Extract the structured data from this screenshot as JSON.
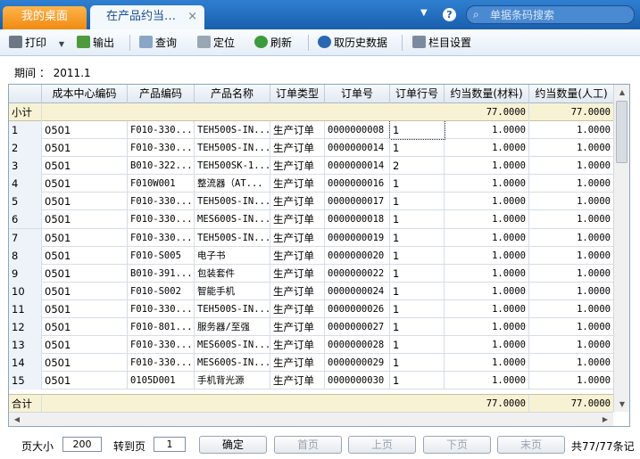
{
  "tabs": {
    "home": "我的桌面",
    "active": "在产品约当…",
    "close": "×"
  },
  "header": {
    "search_placeholder": "单据条码搜索",
    "help": "?",
    "caret": "▼",
    "search_glyph": "⌕"
  },
  "toolbar": {
    "print": "打印",
    "print_arrow": "▼",
    "export": "输出",
    "query": "查询",
    "locate": "定位",
    "refresh": "刷新",
    "history": "取历史数据",
    "columns": "栏目设置"
  },
  "period": {
    "label": "期间 ：",
    "value": "2011.1"
  },
  "table": {
    "headers": [
      "成本中心编码",
      "产品编码",
      "产品名称",
      "订单类型",
      "订单号",
      "订单行号",
      "约当数量(材料)",
      "约当数量(人工)"
    ],
    "subtotal": {
      "label": "小计",
      "material": "77.0000",
      "labor": "77.0000"
    },
    "total": {
      "label": "合计",
      "material": "77.0000",
      "labor": "77.0000"
    },
    "rows": [
      {
        "n": "1",
        "cc": "0501",
        "code": "F010-330...",
        "name": "TEH500S-IN...",
        "type": "生产订单",
        "order": "0000000008",
        "line": "1",
        "m": "1.0000",
        "l": "1.0000"
      },
      {
        "n": "2",
        "cc": "0501",
        "code": "F010-330...",
        "name": "TEH500S-IN...",
        "type": "生产订单",
        "order": "0000000014",
        "line": "1",
        "m": "1.0000",
        "l": "1.0000"
      },
      {
        "n": "3",
        "cc": "0501",
        "code": "B010-322...",
        "name": "TEH500SK-1...",
        "type": "生产订单",
        "order": "0000000014",
        "line": "2",
        "m": "1.0000",
        "l": "1.0000"
      },
      {
        "n": "4",
        "cc": "0501",
        "code": "F010W001",
        "name": "整流器（AT...",
        "type": "生产订单",
        "order": "0000000016",
        "line": "1",
        "m": "1.0000",
        "l": "1.0000"
      },
      {
        "n": "5",
        "cc": "0501",
        "code": "F010-330...",
        "name": "TEH500S-IN...",
        "type": "生产订单",
        "order": "0000000017",
        "line": "1",
        "m": "1.0000",
        "l": "1.0000"
      },
      {
        "n": "6",
        "cc": "0501",
        "code": "F010-330...",
        "name": "MES600S-IN...",
        "type": "生产订单",
        "order": "0000000018",
        "line": "1",
        "m": "1.0000",
        "l": "1.0000"
      },
      {
        "n": "7",
        "cc": "0501",
        "code": "F010-330...",
        "name": "TEH500S-IN...",
        "type": "生产订单",
        "order": "0000000019",
        "line": "1",
        "m": "1.0000",
        "l": "1.0000"
      },
      {
        "n": "8",
        "cc": "0501",
        "code": "F010-S005",
        "name": "电子书",
        "type": "生产订单",
        "order": "0000000020",
        "line": "1",
        "m": "1.0000",
        "l": "1.0000"
      },
      {
        "n": "9",
        "cc": "0501",
        "code": "B010-391...",
        "name": "包装套件",
        "type": "生产订单",
        "order": "0000000022",
        "line": "1",
        "m": "1.0000",
        "l": "1.0000"
      },
      {
        "n": "10",
        "cc": "0501",
        "code": "F010-S002",
        "name": "智能手机",
        "type": "生产订单",
        "order": "0000000024",
        "line": "1",
        "m": "1.0000",
        "l": "1.0000"
      },
      {
        "n": "11",
        "cc": "0501",
        "code": "F010-330...",
        "name": "TEH500S-IN...",
        "type": "生产订单",
        "order": "0000000026",
        "line": "1",
        "m": "1.0000",
        "l": "1.0000"
      },
      {
        "n": "12",
        "cc": "0501",
        "code": "F010-801...",
        "name": "服务器/至强",
        "type": "生产订单",
        "order": "0000000027",
        "line": "1",
        "m": "1.0000",
        "l": "1.0000"
      },
      {
        "n": "13",
        "cc": "0501",
        "code": "F010-330...",
        "name": "MES600S-IN...",
        "type": "生产订单",
        "order": "0000000028",
        "line": "1",
        "m": "1.0000",
        "l": "1.0000"
      },
      {
        "n": "14",
        "cc": "0501",
        "code": "F010-330...",
        "name": "MES600S-IN...",
        "type": "生产订单",
        "order": "0000000029",
        "line": "1",
        "m": "1.0000",
        "l": "1.0000"
      },
      {
        "n": "15",
        "cc": "0501",
        "code": "0105D001",
        "name": "手机背光源",
        "type": "生产订单",
        "order": "0000000030",
        "line": "1",
        "m": "1.0000",
        "l": "1.0000"
      }
    ]
  },
  "pager": {
    "size_label": "页大小",
    "size": "200",
    "goto_label": "转到页",
    "goto": "1",
    "confirm": "确定",
    "first": "首页",
    "prev": "上页",
    "next": "下页",
    "last": "末页",
    "summary": "共77/77条记"
  },
  "colors": {
    "titlebar": "#1a5fae",
    "home_tab": "#f08a12",
    "subtotal_bg": "#f7f2d4"
  }
}
